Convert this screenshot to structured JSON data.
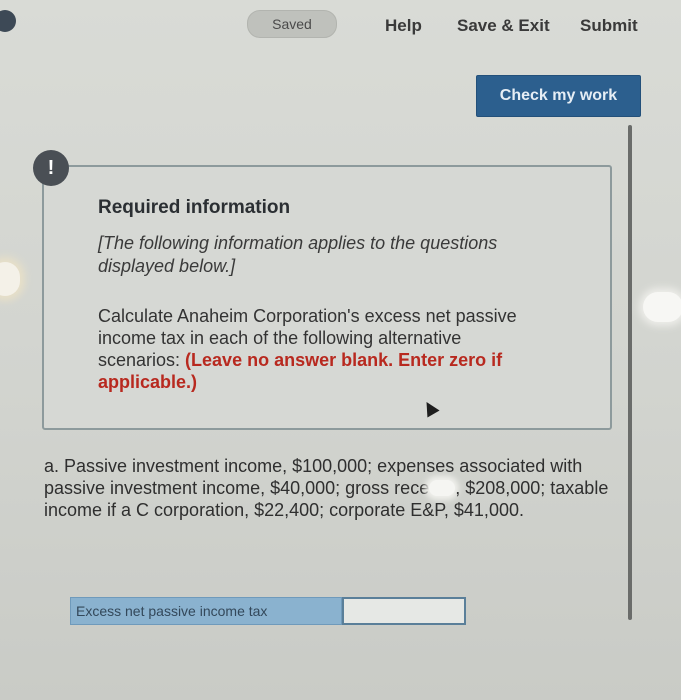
{
  "header": {
    "saved_status": "Saved",
    "help_label": "Help",
    "save_exit_label": "Save & Exit",
    "submit_label": "Submit"
  },
  "check_button": {
    "label": "Check my work"
  },
  "alert": {
    "icon": "exclamation-icon",
    "symbol": "!"
  },
  "info": {
    "title": "Required information",
    "note": "[The following information applies to the questions displayed below.]",
    "body_text": "Calculate Anaheim Corporation's excess net passive income tax in each of the following alternative scenarios: ",
    "body_emphasis": "(Leave no answer blank. Enter zero if applicable.)"
  },
  "question": {
    "part_a_before": "a. Passive investment income, $100,000; expenses associated with passive investment income, $40,000; gross rece",
    "part_a_after": ", $208,000; taxable income if a C corporation, $22,400; corporate E&P, $41,000."
  },
  "answer": {
    "label": "Excess net passive income tax",
    "value": ""
  },
  "colors": {
    "button_bg": "#2c5f8e",
    "emphasis_red": "#b8291f",
    "answer_label_bg": "#8ab2cf"
  }
}
